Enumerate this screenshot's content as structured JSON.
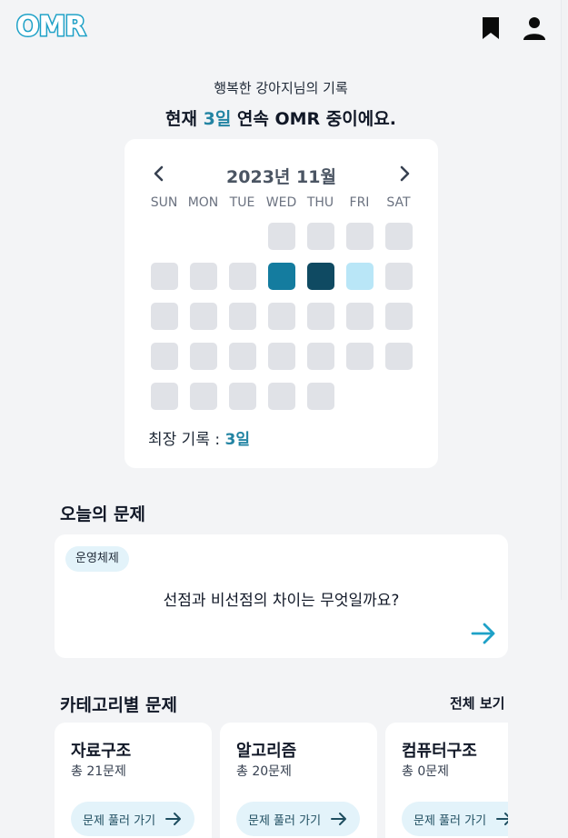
{
  "header": {
    "logo_text": "OMR",
    "brand_color": "#1ea1c7",
    "bookmark_icon": "bookmark-icon",
    "user_icon": "user-icon"
  },
  "streak": {
    "subtitle": "행복한 강아지님의 기록",
    "title_prefix": "현재 ",
    "count": "3일",
    "title_suffix": " 연속 OMR 중이에요.",
    "accent_color": "#2384a3"
  },
  "calendar": {
    "month_label": "2023년 11월",
    "prev_icon": "chevron-left-icon",
    "next_icon": "chevron-right-icon",
    "weekdays": [
      "SUN",
      "MON",
      "TUE",
      "WED",
      "THU",
      "FRI",
      "SAT"
    ],
    "first_weekday_index": 3,
    "days_in_month": 30,
    "activity_levels": [
      0,
      0,
      0,
      0,
      0,
      0,
      0,
      2,
      3,
      1,
      0,
      0,
      0,
      0,
      0,
      0,
      0,
      0,
      0,
      0,
      0,
      0,
      0,
      0,
      0,
      0,
      0,
      0,
      0,
      0
    ],
    "level_colors": [
      "#e0e2e7",
      "#b9e6f7",
      "#147c9f",
      "#0f4a62"
    ],
    "best_label": "최장 기록 : ",
    "best_value": "3일"
  },
  "today": {
    "section_title": "오늘의 문제",
    "category_chip": "운영체제",
    "question": "선점과 비선점의 차이는 무엇일까요?",
    "arrow_icon": "arrow-right-icon"
  },
  "categories": {
    "section_title": "카테고리별 문제",
    "view_all": "전체 보기",
    "items": [
      {
        "name": "자료구조",
        "count": "총 21문제",
        "button": "문제 풀러 가기"
      },
      {
        "name": "알고리즘",
        "count": "총 20문제",
        "button": "문제 풀러 가기"
      },
      {
        "name": "컴퓨터구조",
        "count": "총 0문제",
        "button": "문제 풀러 가기"
      }
    ]
  }
}
